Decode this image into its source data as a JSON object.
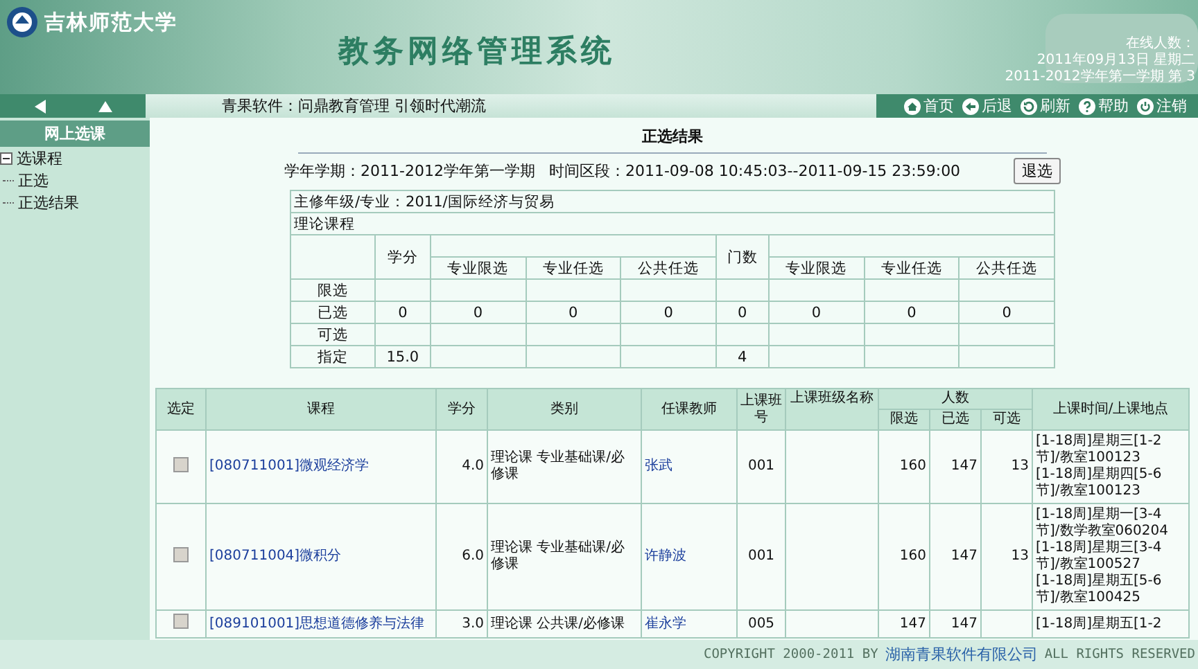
{
  "header": {
    "logo_text": "吉林师范大学",
    "system_title": "教务网络管理系统",
    "online_label": "在线人数：",
    "date": "2011年09月13日 星期二",
    "term_week": "2011-2012学年第一学期 第 3"
  },
  "nav": {
    "slogan": "青果软件：问鼎教育管理 引领时代潮流",
    "links": [
      {
        "label": "首页",
        "kind": "home"
      },
      {
        "label": "后退",
        "kind": "back"
      },
      {
        "label": "刷新",
        "kind": "refresh"
      },
      {
        "label": "帮助",
        "kind": "help"
      },
      {
        "label": "注销",
        "kind": "logout"
      }
    ]
  },
  "sidebar": {
    "title": "网上选课",
    "tree": [
      {
        "label": "选课程",
        "expanded": true,
        "children": [
          {
            "label": "正选"
          },
          {
            "label": "正选结果"
          }
        ]
      }
    ]
  },
  "page_title": "正选结果",
  "term": "学年学期：2011-2012学年第一学期",
  "period": "时间区段：2011-09-08 10:45:03--2011-09-15 23:59:00",
  "withdraw_button": "退选",
  "summary": {
    "major": "主修年级/专业：2011/国际经济与贸易",
    "section": "理论课程",
    "credit_header": "学分",
    "count_header": "门数",
    "credit_categories": [
      "专业限选",
      "专业任选",
      "公共任选"
    ],
    "count_categories": [
      "专业限选",
      "专业任选",
      "公共任选"
    ],
    "rows": [
      {
        "label": "限选",
        "cells": [
          null,
          null,
          null,
          null,
          null,
          null,
          null,
          null
        ]
      },
      {
        "label": "已选",
        "cells": [
          "0",
          "0",
          "0",
          "0",
          "0",
          "0",
          "0",
          "0"
        ]
      },
      {
        "label": "可选",
        "cells": [
          null,
          null,
          null,
          null,
          null,
          null,
          null,
          null
        ]
      },
      {
        "label": "指定",
        "cells": [
          "15.0",
          null,
          null,
          null,
          "4",
          null,
          null,
          null
        ]
      }
    ]
  },
  "courses": {
    "headers": {
      "select": "选定",
      "course": "课程",
      "credit": "学分",
      "category": "类别",
      "teacher": "任课教师",
      "class_no": "上课班号",
      "class_name": "上课班级名称",
      "enrollment": "人数",
      "limit": "限选",
      "enrolled": "已选",
      "available": "可选",
      "schedule": "上课时间/上课地点"
    },
    "rows": [
      {
        "checked": false,
        "course": "[080711001]微观经济学",
        "credit": "4.0",
        "category": "理论课 专业基础课/必修课",
        "teacher": "张武",
        "class_no": "001",
        "limit": "160",
        "enrolled": "147",
        "available": "13",
        "schedule": [
          "[1-18周]星期三[1-2节]/教室100123",
          "[1-18周]星期四[5-6节]/教室100123"
        ]
      },
      {
        "checked": false,
        "course": "[080711004]微积分",
        "credit": "6.0",
        "category": "理论课 专业基础课/必修课",
        "teacher": "许静波",
        "class_no": "001",
        "limit": "160",
        "enrolled": "147",
        "available": "13",
        "schedule": [
          "[1-18周]星期一[3-4节]/数学教室060204",
          "[1-18周]星期三[3-4节]/教室100527",
          "[1-18周]星期五[5-6节]/教室100425"
        ]
      },
      {
        "checked": false,
        "course": "[089101001]思想道德修养与法律",
        "credit": "3.0",
        "category": "理论课 公共课/必修课",
        "teacher": "崔永学",
        "class_no": "005",
        "limit": "147",
        "enrolled": "147",
        "schedule": [
          "[1-18周]星期五[1-2"
        ]
      }
    ]
  },
  "footer": {
    "prefix": "COPYRIGHT 2000-2011 BY",
    "company": "湖南青果软件有限公司",
    "suffix": "ALL RIGHTS RESERVED"
  }
}
